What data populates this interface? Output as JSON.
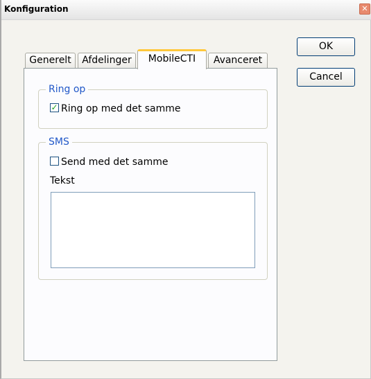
{
  "window": {
    "title": "Konfiguration",
    "close_icon": "close-icon"
  },
  "tabs": [
    {
      "label": "Generelt",
      "active": false
    },
    {
      "label": "Afdelinger",
      "active": false
    },
    {
      "label": "MobileCTI",
      "active": true
    },
    {
      "label": "Avanceret",
      "active": false
    }
  ],
  "ring_op": {
    "legend": "Ring op",
    "checkbox_label": "Ring op med det samme",
    "checked": true
  },
  "sms": {
    "legend": "SMS",
    "checkbox_label": "Send med det samme",
    "checked": false,
    "text_label": "Tekst",
    "text_value": ""
  },
  "buttons": {
    "ok": "OK",
    "cancel": "Cancel"
  },
  "colors": {
    "legend": "#2158c8",
    "active_tab_highlight": "#ffc83c",
    "check": "#21a121"
  }
}
